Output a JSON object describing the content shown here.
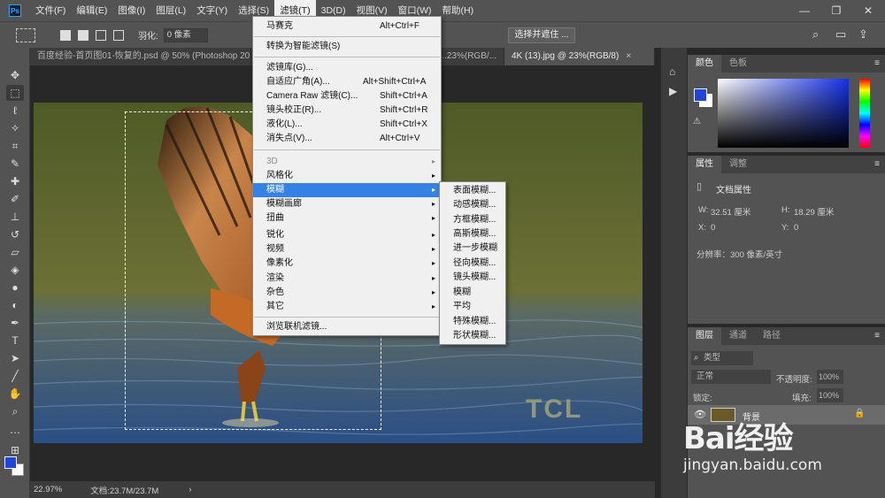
{
  "menubar": {
    "app_icon": "Ps",
    "items": [
      "文件(F)",
      "编辑(E)",
      "图像(I)",
      "图层(L)",
      "文字(Y)",
      "选择(S)",
      "滤镜(T)",
      "3D(D)",
      "视图(V)",
      "窗口(W)",
      "帮助(H)"
    ],
    "active_index": 6,
    "window_controls": [
      "—",
      "❐",
      "✕"
    ]
  },
  "options_bar": {
    "feather_label": "羽化:",
    "feather_value": "0 像素",
    "select_mask_button": "选择并遮住 ..."
  },
  "tabs": [
    {
      "label": "百度经验-首页图01-恢复的.psd @ 50% (Photoshop 2016 ...",
      "active": false
    },
    {
      "label": "...23%(RGB/...",
      "active": false
    },
    {
      "label": "4K (13).jpg @ 23%(RGB/8)",
      "active": true,
      "close": "×"
    }
  ],
  "canvas": {
    "photo_watermark": "TCL"
  },
  "statusbar": {
    "zoom": "22.97%",
    "doc_size": "文档:23.7M/23.7M",
    "arrow": "›"
  },
  "color_panel": {
    "tabs": [
      "颜色",
      "色板"
    ],
    "fg_color": "#1f46d8",
    "bg_color": "#ffffff"
  },
  "properties_panel": {
    "tabs": [
      "属性",
      "调整"
    ],
    "section_title": "文档属性",
    "w_label": "W:",
    "w_value": "32.51 厘米",
    "h_label": "H:",
    "h_value": "18.29 厘米",
    "x_label": "X:",
    "x_value": "0",
    "y_label": "Y:",
    "y_value": "0",
    "resolution": "分辨率：300 像素/英寸"
  },
  "layers_panel": {
    "tabs": [
      "图层",
      "通道",
      "路径"
    ],
    "filter_placeholder": "类型",
    "blend_mode": "正常",
    "opacity_label": "不透明度:",
    "opacity_value": "100%",
    "lock_label": "锁定:",
    "fill_label": "填充:",
    "fill_value": "100%",
    "layer_name": "背景"
  },
  "filter_menu": {
    "items": [
      {
        "label": "马赛克",
        "shortcut": "Alt+Ctrl+F"
      },
      {
        "label": "转换为智能滤镜(S)",
        "shortcut": ""
      },
      {
        "label": "滤镜库(G)...",
        "shortcut": ""
      },
      {
        "label": "自适应广角(A)...",
        "shortcut": "Alt+Shift+Ctrl+A"
      },
      {
        "label": "Camera Raw 滤镜(C)...",
        "shortcut": "Shift+Ctrl+A"
      },
      {
        "label": "镜头校正(R)...",
        "shortcut": "Shift+Ctrl+R"
      },
      {
        "label": "液化(L)...",
        "shortcut": "Shift+Ctrl+X"
      },
      {
        "label": "消失点(V)...",
        "shortcut": "Alt+Ctrl+V"
      },
      {
        "label": "3D",
        "submenu": true,
        "disabled": true
      },
      {
        "label": "风格化",
        "submenu": true
      },
      {
        "label": "模糊",
        "submenu": true,
        "highlighted": true
      },
      {
        "label": "模糊画廊",
        "submenu": true
      },
      {
        "label": "扭曲",
        "submenu": true
      },
      {
        "label": "锐化",
        "submenu": true
      },
      {
        "label": "视频",
        "submenu": true
      },
      {
        "label": "像素化",
        "submenu": true
      },
      {
        "label": "渲染",
        "submenu": true
      },
      {
        "label": "杂色",
        "submenu": true
      },
      {
        "label": "其它",
        "submenu": true
      },
      {
        "label": "浏览联机滤镜...",
        "shortcut": ""
      }
    ],
    "submenu_arrow": "▸"
  },
  "blur_submenu": {
    "items": [
      "表面模糊...",
      "动感模糊...",
      "方框模糊...",
      "高斯模糊...",
      "进一步模糊",
      "径向模糊...",
      "镜头模糊...",
      "模糊",
      "平均",
      "特殊模糊...",
      "形状模糊..."
    ]
  },
  "overlay": {
    "baidu_logo": "Bai经验",
    "baidu_url": "jingyan.baidu.com"
  },
  "colors": {
    "highlight": "#3582e6",
    "arrow": "#3a4fd1"
  }
}
